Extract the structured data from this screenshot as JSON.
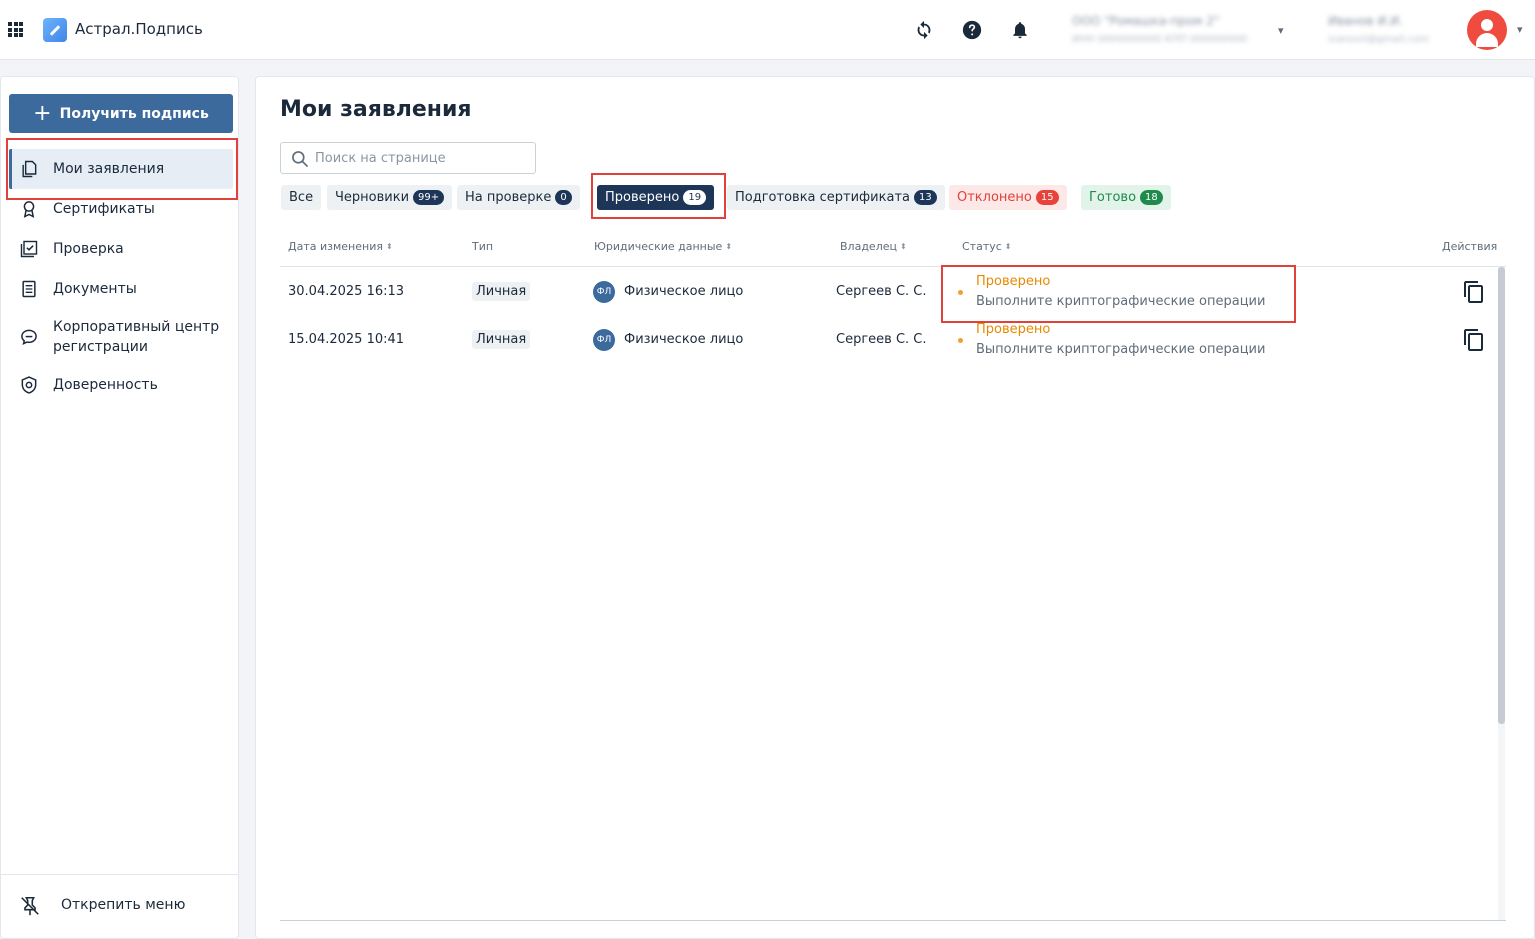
{
  "header": {
    "app_title": "Астрал.Подпись",
    "org_name": "ООО \"Ромашка-пром 2\"",
    "org_details": "ИНН 0000000000 КПП 000000000",
    "user_name": "Иванов И.И.",
    "user_email": "ivanovii@gmail.com",
    "icons": [
      "apps-grid-icon",
      "refresh-icon",
      "help-icon",
      "bell-icon",
      "avatar-icon"
    ]
  },
  "sidebar": {
    "get_sign_button": "Получить подпись",
    "items": [
      {
        "label": "Мои заявления",
        "icon": "documents-icon",
        "active": true
      },
      {
        "label": "Сертификаты",
        "icon": "certificate-icon"
      },
      {
        "label": "Проверка",
        "icon": "check-icon"
      },
      {
        "label": "Документы",
        "icon": "document-icon"
      },
      {
        "label": "Корпоративный центр регистрации",
        "icon": "chat-icon"
      },
      {
        "label": "Доверенность",
        "icon": "shield-icon"
      }
    ],
    "unpin_label": "Открепить меню"
  },
  "main": {
    "title": "Мои заявления",
    "search_placeholder": "Поиск на странице",
    "tabs": [
      {
        "label": "Все"
      },
      {
        "label": "Черновики",
        "count": "99+"
      },
      {
        "label": "На проверке",
        "count": "0"
      },
      {
        "label": "Проверено",
        "count": "19",
        "selected": true
      },
      {
        "label": "Подготовка сертификата",
        "count": "13"
      },
      {
        "label": "Отклонено",
        "count": "15",
        "color": "#e0413a"
      },
      {
        "label": "Готово",
        "count": "18",
        "color": "#1f8a4c"
      }
    ],
    "columns": [
      "Дата изменения",
      "Тип",
      "Юридические данные",
      "Владелец",
      "Статус",
      "Действия"
    ],
    "rows": [
      {
        "date": "30.04.2025 16:13",
        "type": "Личная",
        "legal_badge": "ФЛ",
        "legal": "Физическое лицо",
        "owner": "Сергеев С. С.",
        "status": "Проверено",
        "status_note": "Выполните криптографические операции"
      },
      {
        "date": "15.04.2025 10:41",
        "type": "Личная",
        "legal_badge": "ФЛ",
        "legal": "Физическое лицо",
        "owner": "Сергеев С. С.",
        "status": "Проверено",
        "status_note": "Выполните криптографические операции"
      }
    ]
  },
  "colors": {
    "primary": "#3d6a9c",
    "tab_selected": "#1d3557",
    "status_checked": "#e68a00",
    "highlight": "#e0413a"
  }
}
